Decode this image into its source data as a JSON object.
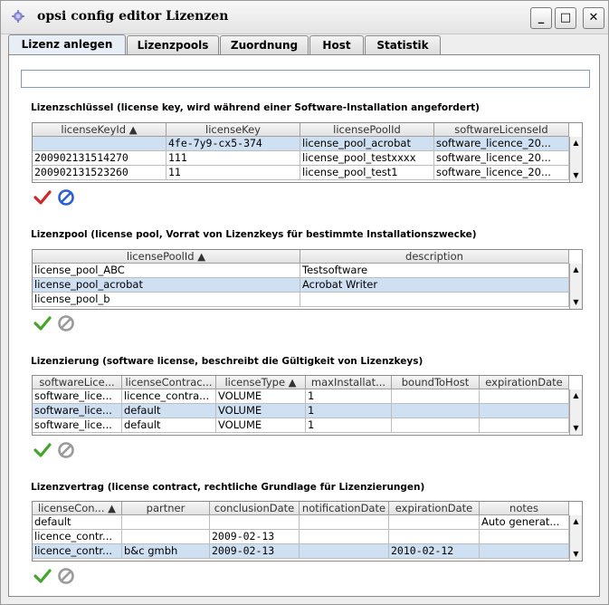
{
  "window": {
    "title": "opsi config editor Lizenzen",
    "minimize": "_",
    "maximize": "□",
    "close": "✕"
  },
  "tabs": [
    "Lizenz anlegen",
    "Lizenzpools",
    "Zuordnung",
    "Host",
    "Statistik"
  ],
  "sections": {
    "keys": {
      "title": "Lizenzschlüssel (license key, wird während einer Software-Installation angefordert)",
      "columns": [
        "licenseKeyId ▲",
        "licenseKey",
        "licensePoolId",
        "softwareLicenseId"
      ],
      "rows": [
        [
          "",
          "4fe-7y9-cx5-374",
          "license_pool_acrobat",
          "software_licence_20..."
        ],
        [
          "200902131514270",
          "111",
          "license_pool_testxxxx",
          "software_licence_20..."
        ],
        [
          "200902131523260",
          "11",
          "license_pool_test1",
          "software_licence_20..."
        ]
      ]
    },
    "pools": {
      "title": "Lizenzpool (license pool, Vorrat von Lizenzkeys für bestimmte Installationszwecke)",
      "columns": [
        "licensePoolId ▲",
        "description"
      ],
      "rows": [
        [
          "license_pool_ABC",
          "Testsoftware"
        ],
        [
          "license_pool_acrobat",
          "Acrobat Writer"
        ],
        [
          "license_pool_b",
          ""
        ]
      ]
    },
    "licensing": {
      "title": "Lizenzierung (software license, beschreibt die Gültigkeit von Lizenzkeys)",
      "columns": [
        "softwareLice...",
        "licenseContrac...",
        "licenseType ▲",
        "maxInstallat...",
        "boundToHost",
        "expirationDate"
      ],
      "rows": [
        [
          "software_lice...",
          "licence_contra...",
          "VOLUME",
          "1",
          "",
          ""
        ],
        [
          "software_lice...",
          "default",
          "VOLUME",
          "1",
          "",
          ""
        ],
        [
          "software_lice...",
          "default",
          "VOLUME",
          "1",
          "",
          ""
        ]
      ]
    },
    "contracts": {
      "title": "Lizenzvertrag (license contract, rechtliche Grundlage für Lizenzierungen)",
      "columns": [
        "licenseCon... ▲",
        "partner",
        "conclusionDate",
        "notificationDate",
        "expirationDate",
        "notes"
      ],
      "rows": [
        [
          "default",
          "",
          "",
          "",
          "",
          "Auto generat..."
        ],
        [
          "licence_contr...",
          "",
          "2009-02-13",
          "",
          "",
          ""
        ],
        [
          "licence_contr...",
          "b&c gmbh",
          "2009-02-13",
          "",
          "2010-02-12",
          ""
        ]
      ]
    }
  },
  "colors": {
    "selection": "#cfe0f2",
    "check_active": "#cc2a2a",
    "check_green": "#44a52a",
    "cancel_blue": "#2f5fcf",
    "disabled": "#9a9a9a"
  }
}
